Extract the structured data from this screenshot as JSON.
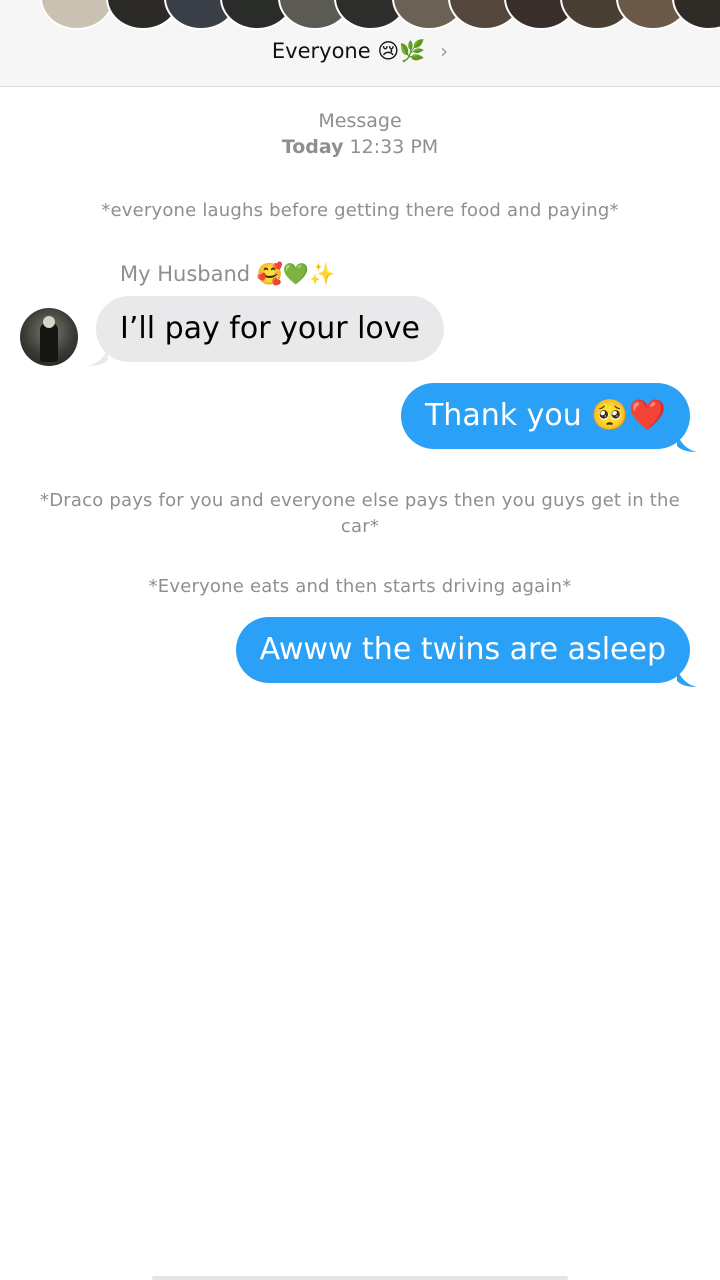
{
  "header": {
    "group_name": "Everyone",
    "group_emoji": "😢🌿",
    "chevron": "›",
    "avatars_colors": [
      "#c9c2b3",
      "#2b2a26",
      "#3b3f47",
      "#2a2c2a",
      "#5b5a53",
      "#2d2e2b",
      "#6a6254",
      "#54463c",
      "#3a2e2a",
      "#4a3f33",
      "#6b5a48",
      "#2f2b26"
    ]
  },
  "timestamp": {
    "service": "Message",
    "day": "Today",
    "time": "12:33 PM"
  },
  "messages": [
    {
      "kind": "narration",
      "text": "*everyone laughs before getting there food and paying*"
    },
    {
      "kind": "sender",
      "text": "My Husband 🥰💚✨"
    },
    {
      "kind": "incoming",
      "text": "I’ll pay for your love"
    },
    {
      "kind": "outgoing",
      "text": "Thank you 🥺❤️"
    },
    {
      "kind": "narration",
      "text": "*Draco pays for you and everyone else pays then you guys get in the car*"
    },
    {
      "kind": "narration",
      "text": "*Everyone eats and then starts driving again*"
    },
    {
      "kind": "outgoing",
      "text": "Awww the twins are asleep"
    }
  ],
  "colors": {
    "outgoing_bubble": "#2aa1f6",
    "incoming_bubble": "#e9e9eb",
    "meta_text": "#8e8e93"
  }
}
